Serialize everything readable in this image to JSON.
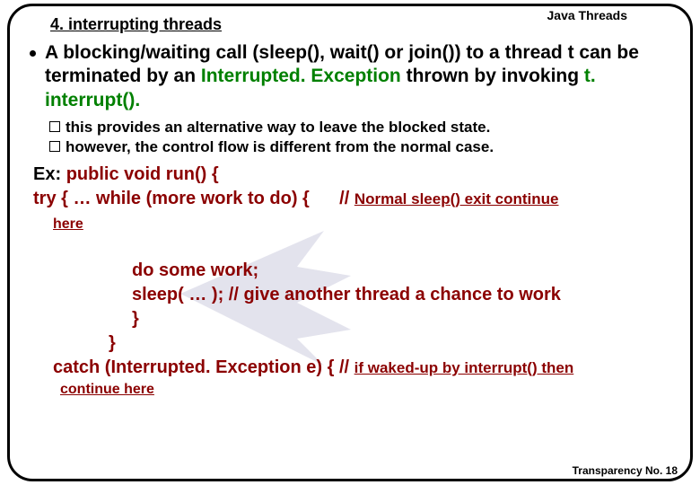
{
  "header": {
    "title": "Java Threads"
  },
  "subtitle": "4. interrupting threads",
  "bullet": {
    "pre": "A blocking/waiting call (sleep(), wait() or join()) to a thread t can be terminated by an ",
    "green1": "Interrupted. Exception",
    "mid": " thrown by invoking ",
    "green2": "t. interrupt().",
    "sub1": "this provides an alternative way to leave the blocked state.",
    "sub2": "however, the control flow is different from the normal case."
  },
  "code": {
    "ex_label": "Ex: ",
    "line1_a": "public void run() {",
    "line2_a": "try { …  while (more work to do) {",
    "line2_slashes": "// ",
    "line2_comment": "Normal sleep() exit continue",
    "here": "here",
    "line3": "do some work;",
    "line4": "sleep( … ); // give another thread a chance to work",
    "line5": "}",
    "line6": "}",
    "catch_a": "catch (Interrupted. Exception e) { ",
    "catch_slashes": "// ",
    "catch_comment": "if waked-up by interrupt() then",
    "continue_here": "continue here"
  },
  "footer": {
    "text": "Transparency No. 18"
  }
}
